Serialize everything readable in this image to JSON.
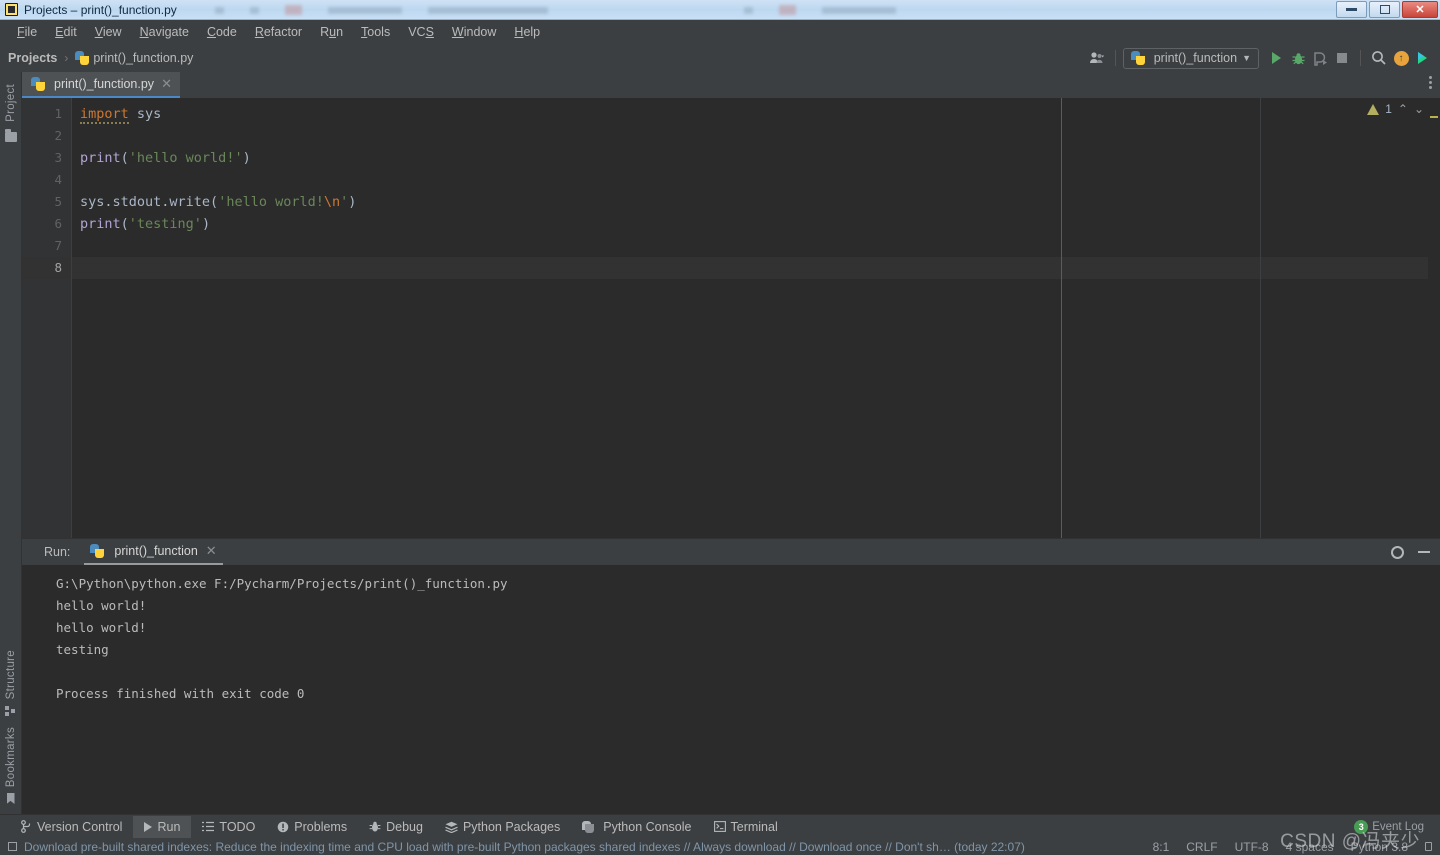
{
  "window": {
    "title": "Projects – print()_function.py",
    "controls": {
      "minimize": "–",
      "restore": "❐",
      "close": "✕"
    }
  },
  "menubar": {
    "items": [
      {
        "label": "File",
        "mnemonic": "F"
      },
      {
        "label": "Edit",
        "mnemonic": "E"
      },
      {
        "label": "View",
        "mnemonic": "V"
      },
      {
        "label": "Navigate",
        "mnemonic": "N"
      },
      {
        "label": "Code",
        "mnemonic": "C"
      },
      {
        "label": "Refactor",
        "mnemonic": "R"
      },
      {
        "label": "Run",
        "mnemonic": "u"
      },
      {
        "label": "Tools",
        "mnemonic": "T"
      },
      {
        "label": "VCS",
        "mnemonic": "S"
      },
      {
        "label": "Window",
        "mnemonic": "W"
      },
      {
        "label": "Help",
        "mnemonic": "H"
      }
    ]
  },
  "navbar": {
    "breadcrumb": {
      "root": "Projects",
      "separator": "›",
      "file": "print()_function.py"
    },
    "run_config": "print()_function",
    "icons": [
      "user-icon",
      "run-icon",
      "debug-icon",
      "coverage-icon",
      "stop-icon",
      "search-icon",
      "update-icon",
      "code-with-me-icon"
    ]
  },
  "left_rail": {
    "top": [
      {
        "label": "Project",
        "icon": "folder-icon"
      }
    ],
    "bottom": [
      {
        "label": "Structure",
        "icon": "structure-icon"
      },
      {
        "label": "Bookmarks",
        "icon": "bookmark-icon"
      }
    ]
  },
  "editor": {
    "tab": {
      "label": "print()_function.py",
      "close": "✕"
    },
    "inspection": {
      "warning_count": "1",
      "up": "⌃",
      "down": "⌄"
    },
    "line_numbers": [
      "1",
      "2",
      "3",
      "4",
      "5",
      "6",
      "7",
      "8"
    ],
    "current_line": 8,
    "lines": [
      {
        "n": 1,
        "tokens": [
          {
            "t": "import",
            "c": "kw",
            "wavy": true
          },
          {
            "t": " ",
            "c": "pl"
          },
          {
            "t": "sys",
            "c": "pl"
          }
        ]
      },
      {
        "n": 2,
        "tokens": []
      },
      {
        "n": 3,
        "tokens": [
          {
            "t": "print",
            "c": "fn"
          },
          {
            "t": "(",
            "c": "pl"
          },
          {
            "t": "'hello world!'",
            "c": "str"
          },
          {
            "t": ")",
            "c": "pl"
          }
        ]
      },
      {
        "n": 4,
        "tokens": []
      },
      {
        "n": 5,
        "tokens": [
          {
            "t": "sys.stdout.write",
            "c": "pl"
          },
          {
            "t": "(",
            "c": "pl"
          },
          {
            "t": "'hello world!",
            "c": "str"
          },
          {
            "t": "\\n",
            "c": "esc"
          },
          {
            "t": "'",
            "c": "str"
          },
          {
            "t": ")",
            "c": "pl"
          }
        ]
      },
      {
        "n": 6,
        "tokens": [
          {
            "t": "print",
            "c": "fn"
          },
          {
            "t": "(",
            "c": "pl"
          },
          {
            "t": "'testing'",
            "c": "str"
          },
          {
            "t": ")",
            "c": "pl"
          }
        ]
      },
      {
        "n": 7,
        "tokens": []
      },
      {
        "n": 8,
        "tokens": []
      }
    ]
  },
  "run_panel": {
    "label": "Run:",
    "tab": {
      "label": "print()_function",
      "close": "✕"
    },
    "actions": [
      "settings-gear-icon",
      "minimize-icon"
    ],
    "output": "G:\\Python\\python.exe F:/Pycharm/Projects/print()_function.py\nhello world!\nhello world!\ntesting\n\nProcess finished with exit code 0"
  },
  "bottom_toolbar": {
    "items": [
      {
        "label": "Version Control",
        "icon": "branch-icon",
        "active": false
      },
      {
        "label": "Run",
        "icon": "run-icon",
        "active": true
      },
      {
        "label": "TODO",
        "icon": "list-icon",
        "active": false
      },
      {
        "label": "Problems",
        "icon": "exclamation-icon",
        "active": false
      },
      {
        "label": "Debug",
        "icon": "bug-icon",
        "active": false
      },
      {
        "label": "Python Packages",
        "icon": "packages-icon",
        "active": false
      },
      {
        "label": "Python Console",
        "icon": "python-icon",
        "active": false
      },
      {
        "label": "Terminal",
        "icon": "terminal-icon",
        "active": false
      }
    ]
  },
  "status_bar": {
    "message": "Download pre-built shared indexes: Reduce the indexing time and CPU load with pre-built Python packages shared indexes // Always download // Download once // Don't sh… (today 22:07)",
    "caret": "8:1",
    "line_separator": "CRLF",
    "encoding": "UTF-8",
    "indent": "4 spaces",
    "interpreter": "Python 3.8",
    "event_log": {
      "label": "Event Log",
      "count": "3"
    }
  },
  "watermark": "CSDN @冯夹少",
  "colors": {
    "background": "#3c3f41",
    "editor_bg": "#2b2b2b",
    "gutter_bg": "#313335",
    "accent_tab": "#4a88c7",
    "keyword": "#cc7832",
    "string": "#6a8759",
    "function": "#b3a4d4",
    "plain": "#a9b7c6",
    "run_green": "#59a869",
    "title_bar": "#c9e0f5"
  }
}
